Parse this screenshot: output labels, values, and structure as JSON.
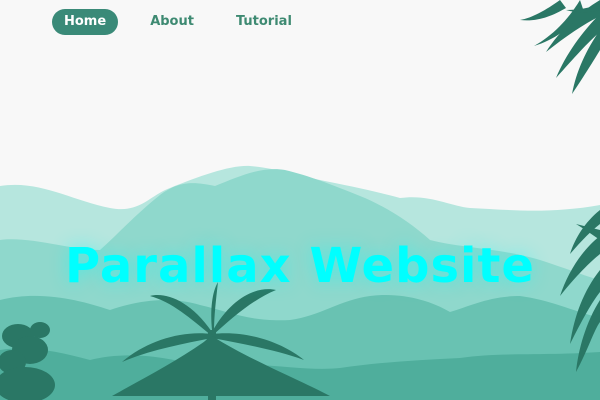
{
  "nav": {
    "items": [
      {
        "label": "Home",
        "active": true
      },
      {
        "label": "About",
        "active": false
      },
      {
        "label": "Tutorial",
        "active": false
      }
    ]
  },
  "hero": {
    "title": "Parallax Website"
  },
  "colors": {
    "accent": "#3a8a78",
    "title": "#00ffff",
    "background": "#f8f8f8",
    "hills_far": "#b6e6de",
    "hills_mid": "#8fd8cc",
    "hills_near": "#69c2b2",
    "foliage": "#2a7765"
  }
}
